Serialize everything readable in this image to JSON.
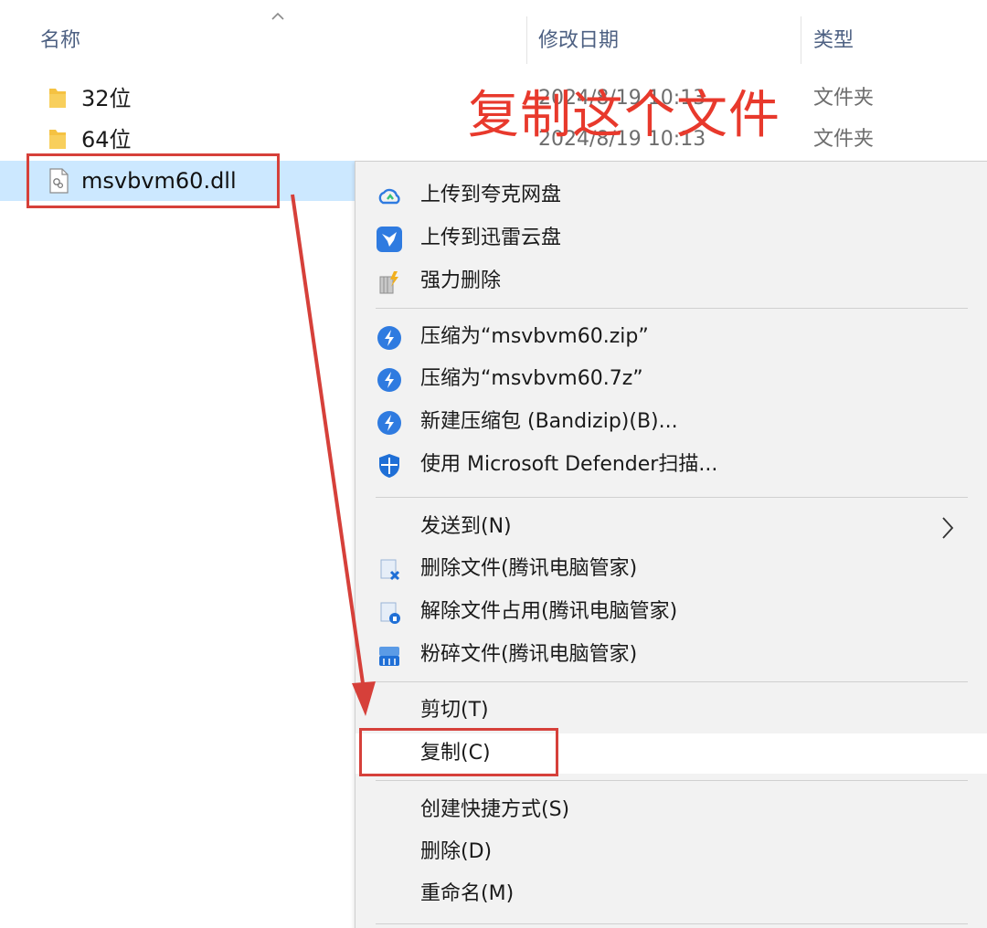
{
  "columns": {
    "name": "名称",
    "date": "修改日期",
    "type": "类型"
  },
  "files": [
    {
      "name": "32位",
      "date": "2024/8/19 10:13",
      "type": "文件夹",
      "icon": "folder-icon"
    },
    {
      "name": "64位",
      "date": "2024/8/19 10:13",
      "type": "文件夹",
      "icon": "folder-icon"
    },
    {
      "name": "msvbvm60.dll",
      "icon": "dll-file-icon",
      "selected": true
    }
  ],
  "annotation": {
    "text": "复制这个文件",
    "color": "#e8392c"
  },
  "context_menu": {
    "items": [
      {
        "label": "上传到夸克网盘",
        "icon": "quark-cloud-icon"
      },
      {
        "label": "上传到迅雷云盘",
        "icon": "xunlei-bird-icon"
      },
      {
        "label": "强力删除",
        "icon": "shred-icon"
      },
      {
        "label": "压缩为“msvbvm60.zip”",
        "icon": "bandizip-icon"
      },
      {
        "label": "压缩为“msvbvm60.7z”",
        "icon": "bandizip-icon"
      },
      {
        "label": "新建压缩包 (Bandizip)(B)...",
        "icon": "bandizip-icon"
      },
      {
        "label": "使用 Microsoft Defender扫描...",
        "icon": "defender-shield-icon"
      },
      {
        "label": "发送到(N)",
        "icon": "chevron-right-icon"
      },
      {
        "label": "删除文件(腾讯电脑管家)",
        "icon": "tencent-delete-icon"
      },
      {
        "label": "解除文件占用(腾讯电脑管家)",
        "icon": "tencent-unlock-icon"
      },
      {
        "label": "粉碎文件(腾讯电脑管家)",
        "icon": "tencent-shred-icon"
      },
      {
        "label": "剪切(T)"
      },
      {
        "label": "复制(C)",
        "highlighted": true
      },
      {
        "label": "创建快捷方式(S)"
      },
      {
        "label": "删除(D)"
      },
      {
        "label": "重命名(M)"
      }
    ]
  },
  "colors": {
    "selection": "#cce8ff",
    "annotation_red": "#d6403a",
    "bandizip_blue": "#2f7be0",
    "folder_yellow": "#f5c242"
  }
}
